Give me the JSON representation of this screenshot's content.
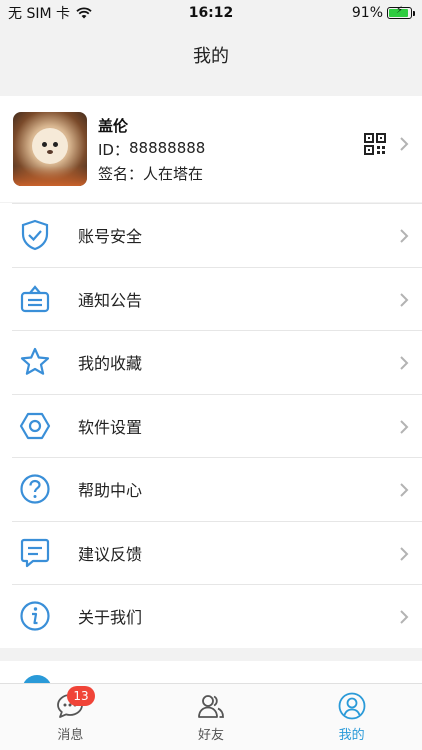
{
  "status_bar": {
    "carrier": "无 SIM 卡",
    "time": "16:12",
    "battery": "91%",
    "battery_level": 0.91
  },
  "nav": {
    "title": "我的"
  },
  "profile": {
    "name": "盖伦",
    "id_label": "ID：",
    "id_value": "88888888",
    "signature_label": "签名：",
    "signature_value": "人在塔在"
  },
  "menu": {
    "items": [
      {
        "label": "账号安全",
        "icon": "shield-check-icon"
      },
      {
        "label": "通知公告",
        "icon": "notice-board-icon"
      },
      {
        "label": "我的收藏",
        "icon": "star-icon"
      },
      {
        "label": "软件设置",
        "icon": "hexagon-settings-icon"
      },
      {
        "label": "帮助中心",
        "icon": "question-circle-icon"
      },
      {
        "label": "建议反馈",
        "icon": "feedback-message-icon"
      },
      {
        "label": "关于我们",
        "icon": "info-circle-icon"
      }
    ]
  },
  "section2": {
    "peek_label": ""
  },
  "tabs": [
    {
      "label": "消息",
      "icon": "chat-bubble-icon",
      "badge": "13",
      "active": false
    },
    {
      "label": "好友",
      "icon": "friends-icon",
      "active": false
    },
    {
      "label": "我的",
      "icon": "user-circle-icon",
      "active": true
    }
  ],
  "colors": {
    "accent": "#2a9ad8",
    "badge": "#f04438",
    "icon_stroke": "#3a8fd8",
    "battery": "#2ecc40"
  }
}
